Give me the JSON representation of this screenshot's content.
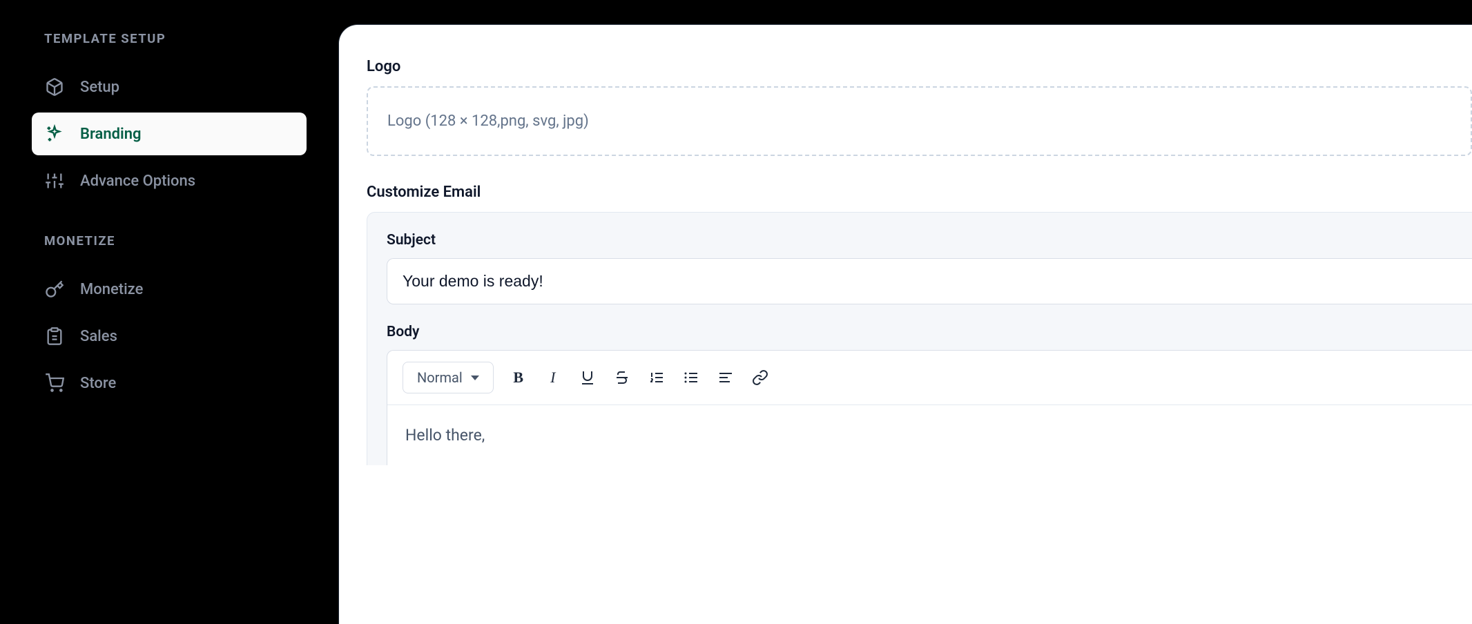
{
  "sidebar": {
    "sections": {
      "template_setup": {
        "header": "TEMPLATE SETUP",
        "items": [
          {
            "id": "setup",
            "label": "Setup"
          },
          {
            "id": "branding",
            "label": "Branding"
          },
          {
            "id": "advance-options",
            "label": "Advance Options"
          }
        ],
        "active": "branding"
      },
      "monetize": {
        "header": "MONETIZE",
        "items": [
          {
            "id": "monetize",
            "label": "Monetize"
          },
          {
            "id": "sales",
            "label": "Sales"
          },
          {
            "id": "store",
            "label": "Store"
          }
        ]
      }
    }
  },
  "main": {
    "logo": {
      "label": "Logo",
      "placeholder": "Logo (128 × 128,png, svg, jpg)"
    },
    "customize_email_label": "Customize Email",
    "email": {
      "subject_label": "Subject",
      "subject_value": "Your demo is ready!",
      "body_label": "Body",
      "toolbar": {
        "style_select": "Normal"
      },
      "body_content": "Hello there,"
    }
  }
}
